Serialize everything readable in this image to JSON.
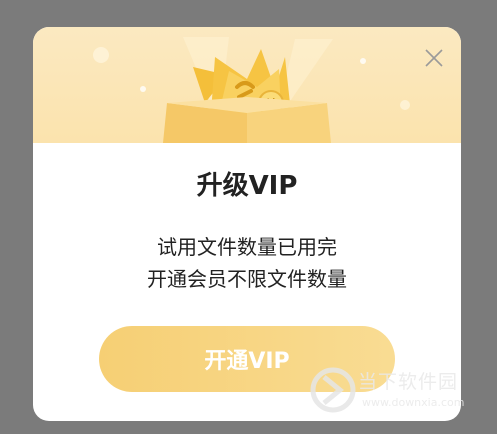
{
  "dialog": {
    "title": "升级VIP",
    "description_line1": "试用文件数量已用完",
    "description_line2": "开通会员不限文件数量",
    "cta_label": "开通VIP",
    "hero_coin_symbol": "¥",
    "icons": [
      "close-icon",
      "treasure-box-illustration"
    ]
  },
  "watermark": {
    "title": "当下软件园",
    "url": "www.downxia.com"
  },
  "colors": {
    "overlay": "#7b7b7b",
    "hero_bg": "#fbe6b6",
    "button": "#f8d683",
    "button_text": "#ffffff",
    "text": "#222222"
  }
}
